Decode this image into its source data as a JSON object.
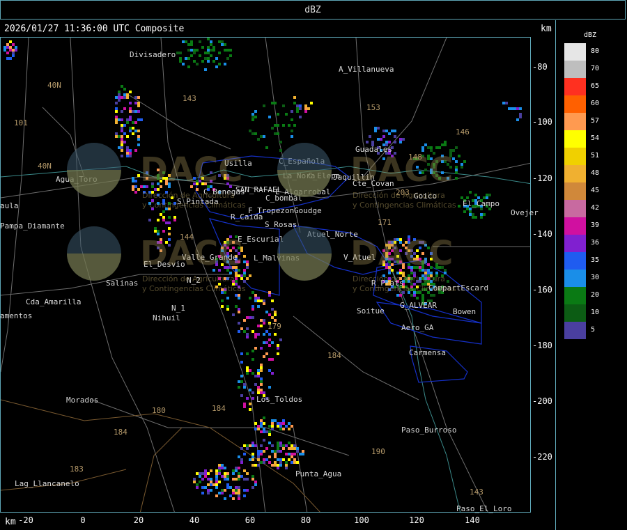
{
  "window_title": "dBZ",
  "header": {
    "title": "2026/01/27 11:36:00 UTC Composite",
    "unit": "km"
  },
  "x_axis": {
    "unit": "km",
    "ticks": [
      -20,
      0,
      20,
      40,
      60,
      80,
      100,
      120,
      140
    ]
  },
  "y_axis": {
    "unit": "km",
    "ticks": [
      -80,
      -100,
      -120,
      -140,
      -160,
      -180,
      -200,
      -220
    ]
  },
  "legend": {
    "title": "dBZ",
    "items": [
      {
        "label": "80",
        "color": "#e6e6e6"
      },
      {
        "label": "70",
        "color": "#bebebe"
      },
      {
        "label": "65",
        "color": "#ff3020"
      },
      {
        "label": "60",
        "color": "#ff6000"
      },
      {
        "label": "57",
        "color": "#ff9a50"
      },
      {
        "label": "54",
        "color": "#ffff00"
      },
      {
        "label": "51",
        "color": "#f0d000"
      },
      {
        "label": "48",
        "color": "#f0b030"
      },
      {
        "label": "45",
        "color": "#d0883a"
      },
      {
        "label": "42",
        "color": "#c86aa0"
      },
      {
        "label": "39",
        "color": "#d010a0"
      },
      {
        "label": "36",
        "color": "#8020d0"
      },
      {
        "label": "35",
        "color": "#1f5cf0"
      },
      {
        "label": "30",
        "color": "#1a8ee8"
      },
      {
        "label": "20",
        "color": "#0a7a14"
      },
      {
        "label": "10",
        "color": "#0c5c14"
      },
      {
        "label": "5",
        "color": "#4a3fa0"
      }
    ]
  },
  "places": [
    {
      "name": "Divisadero"
    },
    {
      "name": "A_Villanueva"
    },
    {
      "name": "Guadales"
    },
    {
      "name": "Usilla"
    },
    {
      "name": "C_Española"
    },
    {
      "name": "La_Nora"
    },
    {
      "name": "C_Elepa"
    },
    {
      "name": "Jaquillin"
    },
    {
      "name": "Cte_Covan"
    },
    {
      "name": "C_Benegas"
    },
    {
      "name": "SAN_RAFAEL"
    },
    {
      "name": "E_Algarrobal"
    },
    {
      "name": "C_bombal"
    },
    {
      "name": "Goico"
    },
    {
      "name": "El_Campo"
    },
    {
      "name": "Ovejer"
    },
    {
      "name": "Agua_Toro"
    },
    {
      "name": "S_Pintada"
    },
    {
      "name": "F_Tropezon"
    },
    {
      "name": "Goudge"
    },
    {
      "name": "aula"
    },
    {
      "name": "Pampa_Diamante"
    },
    {
      "name": "R_Caida"
    },
    {
      "name": "S_Rosas"
    },
    {
      "name": "Atuel_Norte"
    },
    {
      "name": "E_Escurial"
    },
    {
      "name": "V_Atuel"
    },
    {
      "name": "El_Desvio"
    },
    {
      "name": "Valle_Grande"
    },
    {
      "name": "L_Malvinas"
    },
    {
      "name": "R_Prats"
    },
    {
      "name": "CompartEscard"
    },
    {
      "name": "Salinas"
    },
    {
      "name": "Cda_Amarilla"
    },
    {
      "name": "G_ALVEAR"
    },
    {
      "name": "Soitue"
    },
    {
      "name": "Bowen"
    },
    {
      "name": "amentos"
    },
    {
      "name": "N_1"
    },
    {
      "name": "N_2"
    },
    {
      "name": "Nihuil"
    },
    {
      "name": "Aero_GA"
    },
    {
      "name": "Carmensa"
    },
    {
      "name": "Morados"
    },
    {
      "name": "Los_Toldos"
    },
    {
      "name": "Paso_Burroso"
    },
    {
      "name": "Punta_Agua"
    },
    {
      "name": "Lag_Llancanelo"
    },
    {
      "name": "Paso_El_Loro"
    }
  ],
  "routes": [
    "143",
    "101",
    "40N",
    "153",
    "146",
    "148",
    "203",
    "171",
    "144",
    "40N",
    "179",
    "184",
    "180",
    "184",
    "184",
    "183",
    "190",
    "143"
  ],
  "watermark": {
    "logo_text": "DACC",
    "subtitle_1": "Dirección de Agricultura",
    "subtitle_2": "y Contingencias Climáticas"
  }
}
